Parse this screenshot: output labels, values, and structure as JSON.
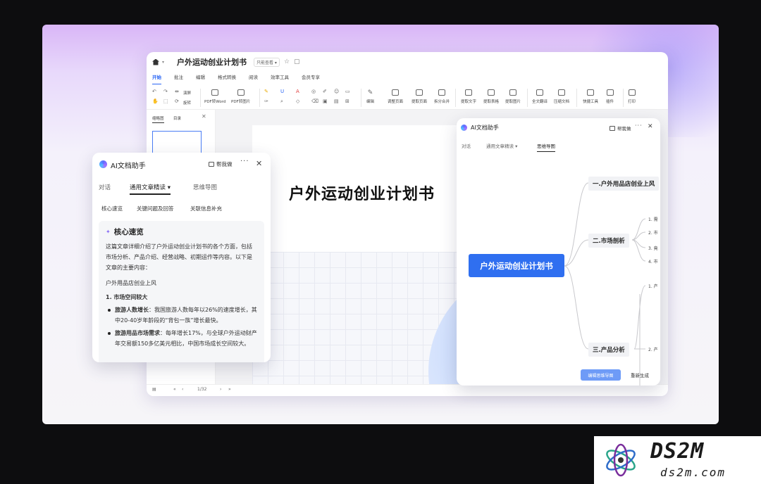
{
  "app": {
    "doc_title": "户外运动创业计划书",
    "readonly_badge": "只能查看 ▾",
    "menu_tabs": [
      "开始",
      "批注",
      "编辑",
      "格式转换",
      "阅读",
      "效率工具",
      "会员专享"
    ],
    "toolbar": {
      "rotate_screen": "演屏",
      "rotate": "旋转",
      "pdf_to_word": "PDF转Word",
      "pdf_to_image": "PDF转图片",
      "edit": "编辑",
      "adjust_page": "调整页面",
      "extract_page": "提取页面",
      "split_merge": "拆分合并",
      "extract_text": "提取文字",
      "extract_table": "提取表格",
      "extract_image": "提取图片",
      "full_translate": "全文翻译",
      "compress": "压缩文档",
      "quick_tools": "快捷工具",
      "plugins": "插件",
      "print": "打印"
    },
    "left_tabs": [
      "缩略图",
      "目录"
    ],
    "page_title": "户外运动创业计划书",
    "page_indicator": "1/32"
  },
  "ai_left": {
    "title": "AI文档助手",
    "help_me": "帮我做",
    "tabs": [
      "对话",
      "通用文章精读 ▾",
      "思维导图"
    ],
    "chips": [
      "核心速览",
      "关键问题及回答",
      "关联信息补充"
    ],
    "card_heading": "核心速览",
    "intro": "这篇文章详细介绍了户外运动创业计划书的各个方面，包括市场分析、产品介绍、经营战略、初期运作等内容。以下是文章的主要内容：",
    "section": "户外用品店创业上风",
    "sub_heading": "1. 市场空间较大",
    "bullets": [
      {
        "label": "旅游人数增长",
        "text": "：我国旅游人数每年以26%的速度增长，其中20-40岁年龄段的“背包一族”增长最快。"
      },
      {
        "label": "旅游用品市场需求",
        "text": "：每年增长17%，与全球户外运动财产年交易额150多亿美元相比，中国市场成长空间较大。"
      }
    ]
  },
  "ai_right": {
    "title": "AI文档助手",
    "help_me": "帮我做",
    "tabs": [
      "对话",
      "通用文章精读 ▾",
      "思维导图"
    ],
    "root": "户外运动创业计划书",
    "branches": [
      "一.户外用品店创业上风",
      "二.市场剖析",
      "三.产品分析"
    ],
    "leaves_b2": [
      "1. 需",
      "2. 市",
      "3. 竟",
      "4. 市"
    ],
    "leaves_b3": [
      "1. 产",
      "2. 产"
    ],
    "btn_edit": "编辑思维导图",
    "btn_regen": "重新生成"
  },
  "watermark": {
    "text1": "DS2M",
    "text2": "ds2m.com"
  },
  "colors": {
    "accent": "#2f6ff0",
    "tab_active": "#2a66f5"
  }
}
